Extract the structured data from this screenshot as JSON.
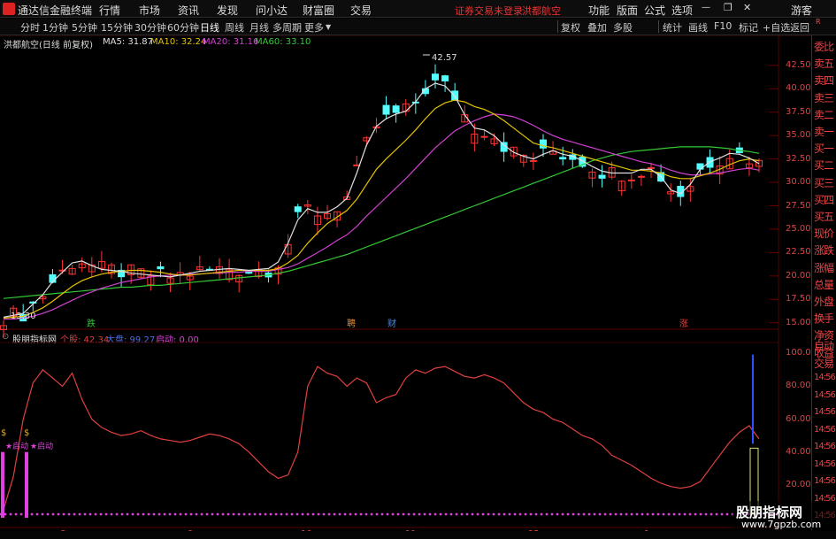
{
  "menu": {
    "app_title": "通达信金融终端",
    "items": [
      "行情",
      "市场",
      "资讯",
      "发现",
      "问小达",
      "财富圈",
      "交易"
    ],
    "notice": "证券交易未登录",
    "stock_name": "洪都航空",
    "right_items": [
      "功能",
      "版面",
      "公式",
      "选项"
    ],
    "user": "游客"
  },
  "periods": [
    "分时",
    "1分钟",
    "5分钟",
    "15分钟",
    "30分钟",
    "60分钟",
    "日线",
    "周线",
    "月线",
    "多周期",
    "更多"
  ],
  "active_period": "日线",
  "toolbar_right": [
    "复权",
    "叠加",
    "多股",
    "统计",
    "画线",
    "F10",
    "标记",
    "+自选",
    "返回"
  ],
  "ma_legend": {
    "title": "洪都航空(日线 前复权)",
    "items": [
      {
        "label": "MA5: 31.87",
        "color": "#e0e0e0"
      },
      {
        "label": "MA10: 32.24",
        "color": "#e6c200"
      },
      {
        "label": "MA20: 31.16",
        "color": "#d040d0"
      },
      {
        "label": "MA60: 33.10",
        "color": "#34c934"
      }
    ]
  },
  "price_axis": [
    "42.50",
    "40.00",
    "37.50",
    "35.00",
    "32.50",
    "30.00",
    "27.50",
    "25.00",
    "22.50",
    "20.00",
    "17.50",
    "15.00"
  ],
  "annotations": {
    "high": "42.57",
    "low": "15.30"
  },
  "event_marks": [
    {
      "text": "跌",
      "color": "#35c035"
    },
    {
      "text": "聘",
      "color": "#e08a2a"
    },
    {
      "text": "财",
      "color": "#4a8ae8"
    },
    {
      "text": "涨",
      "color": "#e04040"
    }
  ],
  "indicator": {
    "name": "股朋指标网",
    "items": [
      {
        "label": "个股: 42.34",
        "color": "#e04040"
      },
      {
        "label": "大盘: 99.27",
        "color": "#4a6ee8"
      },
      {
        "label": "启动: 0.00",
        "color": "#e040e0"
      }
    ],
    "axis": [
      "100.00",
      "80.00",
      "60.00",
      "40.00",
      "20.00"
    ],
    "start_labels": [
      "★启动",
      "★启动"
    ]
  },
  "x_axis": [
    "2024年",
    "8",
    "9",
    "10",
    "11",
    "12",
    "1"
  ],
  "side_panel": [
    "委比",
    "卖五",
    "卖四",
    "卖三",
    "卖二",
    "卖一",
    "买一",
    "买二",
    "买三",
    "买四",
    "买五",
    "现价",
    "涨跌",
    "涨幅",
    "总量",
    "外盘",
    "换手",
    "净资",
    "收益"
  ],
  "side_panel_lower": [
    "自动",
    "交易",
    "14:56",
    "14:56",
    "14:56",
    "14:56",
    "14:56",
    "14:56",
    "14:56",
    "14:56",
    "14:56"
  ],
  "watermark": {
    "line1": "股朋指标网",
    "line2": "www.7gpzb.com"
  },
  "chart_data": {
    "type": "line",
    "y_range": [
      14.5,
      44.0
    ],
    "ma5": [
      15.6,
      15.8,
      16.0,
      17.0,
      18.0,
      19.4,
      20.4,
      21.4,
      21.6,
      21.1,
      20.7,
      20.6,
      20.5,
      20.3,
      20.2,
      20.1,
      20.0,
      19.9,
      20.1,
      20.3,
      20.5,
      20.6,
      20.7,
      20.8,
      20.7,
      20.6,
      20.7,
      20.8,
      21.5,
      23.5,
      26.0,
      27.2,
      26.8,
      26.8,
      27.4,
      28.3,
      31.0,
      34.0,
      36.0,
      36.8,
      37.3,
      37.6,
      38.6,
      40.0,
      40.6,
      40.3,
      39.2,
      37.2,
      35.8,
      35.6,
      35.0,
      34.0,
      33.2,
      32.8,
      32.5,
      33.0,
      33.4,
      33.0,
      32.8,
      32.3,
      31.7,
      31.2,
      31.0,
      31.0,
      31.0,
      31.4,
      31.4,
      30.6,
      29.2,
      28.8,
      29.8,
      31.4,
      32.2,
      32.6,
      33.1,
      33.0,
      32.6,
      32.0
    ],
    "ma10": [
      15.5,
      15.6,
      15.7,
      16.1,
      16.6,
      17.3,
      18.1,
      18.9,
      19.5,
      19.9,
      20.2,
      20.4,
      20.5,
      20.6,
      20.6,
      20.5,
      20.4,
      20.2,
      20.1,
      20.1,
      20.2,
      20.3,
      20.4,
      20.5,
      20.6,
      20.6,
      20.6,
      20.6,
      20.8,
      21.4,
      22.2,
      23.5,
      24.6,
      25.6,
      26.3,
      27.0,
      28.2,
      29.8,
      31.4,
      32.5,
      33.5,
      34.5,
      35.6,
      36.8,
      37.9,
      38.5,
      38.8,
      38.6,
      38.1,
      37.8,
      37.3,
      36.6,
      35.8,
      35.0,
      34.2,
      33.9,
      33.7,
      33.4,
      33.1,
      32.8,
      32.5,
      32.2,
      31.9,
      31.6,
      31.3,
      31.3,
      31.2,
      31.0,
      30.6,
      30.4,
      30.4,
      30.7,
      31.0,
      31.4,
      31.9,
      32.3,
      32.5,
      32.3
    ],
    "ma20": [
      15.4,
      15.4,
      15.5,
      15.7,
      16.0,
      16.4,
      16.9,
      17.4,
      17.9,
      18.3,
      18.7,
      19.0,
      19.3,
      19.5,
      19.7,
      19.9,
      20.0,
      20.1,
      20.1,
      20.2,
      20.2,
      20.3,
      20.3,
      20.4,
      20.4,
      20.5,
      20.5,
      20.5,
      20.7,
      20.9,
      21.3,
      21.9,
      22.5,
      23.1,
      23.8,
      24.4,
      25.3,
      26.4,
      27.4,
      28.4,
      29.4,
      30.4,
      31.5,
      32.6,
      33.7,
      34.6,
      35.5,
      36.1,
      36.6,
      37.0,
      37.3,
      37.2,
      37.0,
      36.6,
      36.1,
      35.5,
      35.0,
      34.6,
      34.3,
      34.0,
      33.7,
      33.4,
      33.1,
      32.8,
      32.5,
      32.2,
      32.0,
      31.7,
      31.3,
      31.0,
      30.8,
      30.8,
      30.9,
      31.0,
      31.2,
      31.4,
      31.5,
      31.3
    ],
    "ma60": [
      17.6,
      17.7,
      17.8,
      17.9,
      18.0,
      18.1,
      18.2,
      18.3,
      18.4,
      18.5,
      18.6,
      18.7,
      18.8,
      18.8,
      18.9,
      19.0,
      19.0,
      19.1,
      19.2,
      19.3,
      19.4,
      19.5,
      19.6,
      19.7,
      19.8,
      19.9,
      20.0,
      20.1,
      20.3,
      20.5,
      20.8,
      21.1,
      21.4,
      21.7,
      22.0,
      22.3,
      22.7,
      23.1,
      23.5,
      23.9,
      24.3,
      24.7,
      25.1,
      25.5,
      25.9,
      26.3,
      26.7,
      27.1,
      27.5,
      27.9,
      28.3,
      28.7,
      29.1,
      29.5,
      29.9,
      30.3,
      30.7,
      31.1,
      31.5,
      31.9,
      32.3,
      32.6,
      32.9,
      33.1,
      33.3,
      33.4,
      33.5,
      33.6,
      33.7,
      33.8,
      33.8,
      33.8,
      33.8,
      33.7,
      33.6,
      33.4,
      33.3,
      33.1
    ],
    "indicator_values": [
      5,
      25,
      60,
      82,
      90,
      85,
      80,
      88,
      72,
      60,
      55,
      52,
      50,
      51,
      53,
      50,
      48,
      47,
      46,
      47,
      49,
      51,
      50,
      48,
      45,
      40,
      34,
      28,
      24,
      26,
      40,
      80,
      92,
      88,
      86,
      80,
      85,
      82,
      70,
      73,
      75,
      85,
      90,
      88,
      91,
      92,
      89,
      86,
      85,
      87,
      85,
      82,
      76,
      70,
      66,
      64,
      60,
      58,
      54,
      50,
      48,
      44,
      38,
      35,
      32,
      28,
      24,
      21,
      19,
      18,
      19,
      22,
      30,
      38,
      46,
      52,
      56,
      48
    ]
  }
}
